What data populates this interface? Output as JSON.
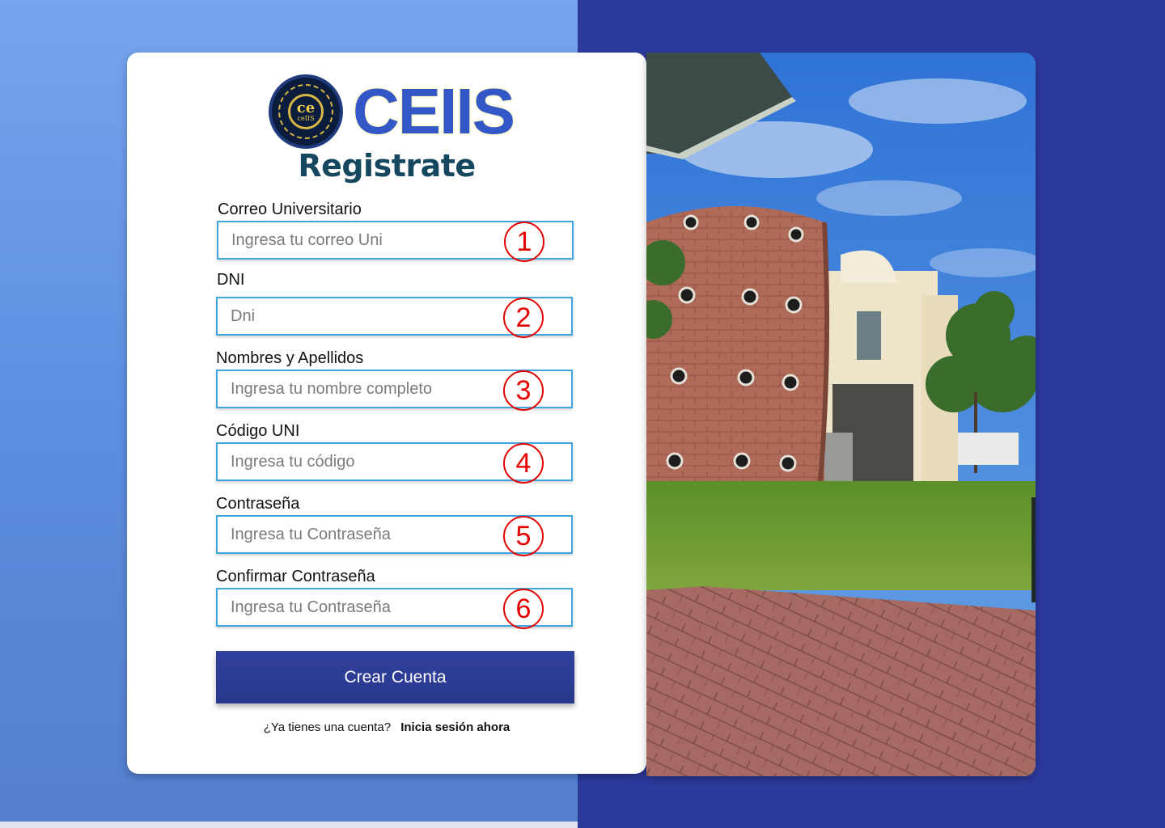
{
  "brand": {
    "emblem_letters": "ce",
    "emblem_sub": "ceIIS",
    "name": "CEIIS"
  },
  "form": {
    "title": "Registrate",
    "fields": [
      {
        "label": "Correo Universitario",
        "placeholder": "Ingresa tu correo Uni",
        "number": "1"
      },
      {
        "label": "DNI",
        "placeholder": "Dni",
        "number": "2"
      },
      {
        "label": "Nombres y Apellidos",
        "placeholder": "Ingresa tu nombre completo",
        "number": "3"
      },
      {
        "label": "Código UNI",
        "placeholder": "Ingresa tu código",
        "number": "4"
      },
      {
        "label": "Contraseña",
        "placeholder": "Ingresa tu Contraseña",
        "number": "5"
      },
      {
        "label": "Confirmar Contraseña",
        "placeholder": "Ingresa tu Contraseña",
        "number": "6"
      }
    ],
    "submit_label": "Crear Cuenta",
    "footer_question": "¿Ya tienes una cuenta?",
    "footer_link": "Inicia sesión ahora"
  },
  "colors": {
    "bg_left": "#76a4ef",
    "bg_right": "#2c3a9c",
    "field_border": "#3fa4e0",
    "title": "#15475e",
    "button": "#2c3a9c",
    "badge": "#e50000"
  }
}
